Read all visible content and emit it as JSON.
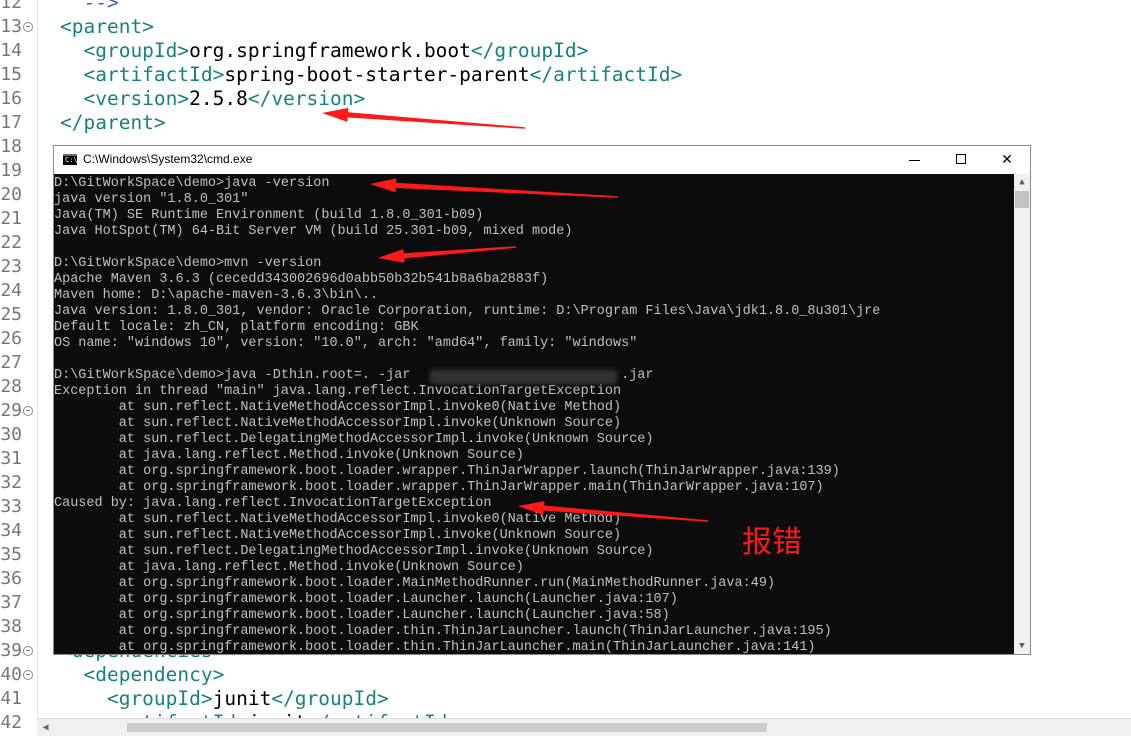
{
  "editor": {
    "lines": [
      {
        "num": "12",
        "fold": false,
        "parts": [
          {
            "t": "  -->",
            "c": "cmt"
          }
        ]
      },
      {
        "num": "13",
        "fold": true,
        "parts": [
          {
            "t": "<parent>",
            "c": "tag"
          }
        ]
      },
      {
        "num": "14",
        "fold": false,
        "parts": [
          {
            "t": "  <groupId>",
            "c": "tag"
          },
          {
            "t": "org.springframework.boot",
            "c": "txt"
          },
          {
            "t": "</groupId>",
            "c": "tag"
          }
        ]
      },
      {
        "num": "15",
        "fold": false,
        "parts": [
          {
            "t": "  <artifactId>",
            "c": "tag"
          },
          {
            "t": "spring-boot-starter-parent",
            "c": "txt"
          },
          {
            "t": "</artifactId>",
            "c": "tag"
          }
        ]
      },
      {
        "num": "16",
        "fold": false,
        "parts": [
          {
            "t": "  <version>",
            "c": "tag"
          },
          {
            "t": "2.5.8",
            "c": "txt"
          },
          {
            "t": "</version>",
            "c": "tag"
          }
        ]
      },
      {
        "num": "17",
        "fold": false,
        "parts": [
          {
            "t": "</parent>",
            "c": "tag"
          }
        ]
      },
      {
        "num": "18",
        "fold": false,
        "parts": []
      },
      {
        "num": "19",
        "fold": false,
        "parts": []
      },
      {
        "num": "20",
        "fold": false,
        "parts": []
      },
      {
        "num": "21",
        "fold": false,
        "parts": []
      },
      {
        "num": "22",
        "fold": false,
        "parts": []
      },
      {
        "num": "23",
        "fold": false,
        "parts": []
      },
      {
        "num": "24",
        "fold": false,
        "parts": []
      },
      {
        "num": "25",
        "fold": false,
        "parts": []
      },
      {
        "num": "26",
        "fold": false,
        "parts": []
      },
      {
        "num": "27",
        "fold": false,
        "parts": []
      },
      {
        "num": "28",
        "fold": false,
        "parts": []
      },
      {
        "num": "29",
        "fold": true,
        "parts": []
      },
      {
        "num": "30",
        "fold": false,
        "parts": []
      },
      {
        "num": "31",
        "fold": false,
        "parts": []
      },
      {
        "num": "32",
        "fold": false,
        "parts": []
      },
      {
        "num": "33",
        "fold": false,
        "parts": []
      },
      {
        "num": "34",
        "fold": false,
        "parts": []
      },
      {
        "num": "35",
        "fold": false,
        "parts": []
      },
      {
        "num": "36",
        "fold": false,
        "parts": []
      },
      {
        "num": "37",
        "fold": false,
        "parts": []
      },
      {
        "num": "38",
        "fold": false,
        "parts": []
      },
      {
        "num": "39",
        "fold": true,
        "parts": [
          {
            "t": "<dependencies>",
            "c": "tag"
          }
        ]
      },
      {
        "num": "40",
        "fold": true,
        "parts": [
          {
            "t": "  <dependency>",
            "c": "tag"
          }
        ]
      },
      {
        "num": "41",
        "fold": false,
        "parts": [
          {
            "t": "    <groupId>",
            "c": "tag"
          },
          {
            "t": "junit",
            "c": "txt"
          },
          {
            "t": "</groupId>",
            "c": "tag"
          }
        ]
      },
      {
        "num": "42",
        "fold": false,
        "parts": [
          {
            "t": "    <artifactId>",
            "c": "tag"
          },
          {
            "t": "junit",
            "c": "txt"
          },
          {
            "t": "</artifactId>",
            "c": "tag"
          }
        ]
      }
    ]
  },
  "cmd": {
    "title": "C:\\Windows\\System32\\cmd.exe",
    "icon_label": "C:\\",
    "minimize_icon": "minimize-icon",
    "maximize_icon": "maximize-icon",
    "close_label": "✕",
    "scroll_up": "▲",
    "scroll_down": "▼",
    "console_lines": [
      "D:\\GitWorkSpace\\demo>java -version",
      "java version \"1.8.0_301\"",
      "Java(TM) SE Runtime Environment (build 1.8.0_301-b09)",
      "Java HotSpot(TM) 64-Bit Server VM (build 25.301-b09, mixed mode)",
      "",
      "D:\\GitWorkSpace\\demo>mvn -version",
      "Apache Maven 3.6.3 (cecedd343002696d0abb50b32b541b8a6ba2883f)",
      "Maven home: D:\\apache-maven-3.6.3\\bin\\..",
      "Java version: 1.8.0_301, vendor: Oracle Corporation, runtime: D:\\Program Files\\Java\\jdk1.8.0_8u301\\jre",
      "Default locale: zh_CN, platform encoding: GBK",
      "OS name: \"windows 10\", version: \"10.0\", arch: \"amd64\", family: \"windows\"",
      "",
      "D:\\GitWorkSpace\\demo>java -Dthin.root=. -jar                          .jar",
      "Exception in thread \"main\" java.lang.reflect.InvocationTargetException",
      "        at sun.reflect.NativeMethodAccessorImpl.invoke0(Native Method)",
      "        at sun.reflect.NativeMethodAccessorImpl.invoke(Unknown Source)",
      "        at sun.reflect.DelegatingMethodAccessorImpl.invoke(Unknown Source)",
      "        at java.lang.reflect.Method.invoke(Unknown Source)",
      "        at org.springframework.boot.loader.wrapper.ThinJarWrapper.launch(ThinJarWrapper.java:139)",
      "        at org.springframework.boot.loader.wrapper.ThinJarWrapper.main(ThinJarWrapper.java:107)",
      "Caused by: java.lang.reflect.InvocationTargetException",
      "        at sun.reflect.NativeMethodAccessorImpl.invoke0(Native Method)",
      "        at sun.reflect.NativeMethodAccessorImpl.invoke(Unknown Source)",
      "        at sun.reflect.DelegatingMethodAccessorImpl.invoke(Unknown Source)",
      "        at java.lang.reflect.Method.invoke(Unknown Source)",
      "        at org.springframework.boot.loader.MainMethodRunner.run(MainMethodRunner.java:49)",
      "        at org.springframework.boot.loader.Launcher.launch(Launcher.java:107)",
      "        at org.springframework.boot.loader.Launcher.launch(Launcher.java:58)",
      "        at org.springframework.boot.loader.thin.ThinJarLauncher.launch(ThinJarLauncher.java:195)",
      "        at org.springframework.boot.loader.thin.ThinJarLauncher.main(ThinJarLauncher.java:141)"
    ]
  },
  "annotation": {
    "label": "报错",
    "arrow_color": "#ff1a1a"
  },
  "colors": {
    "xml_tag": "#17827f",
    "xml_text": "#000000",
    "console_bg": "#0c0c0c",
    "console_fg": "#c0c0c0"
  }
}
